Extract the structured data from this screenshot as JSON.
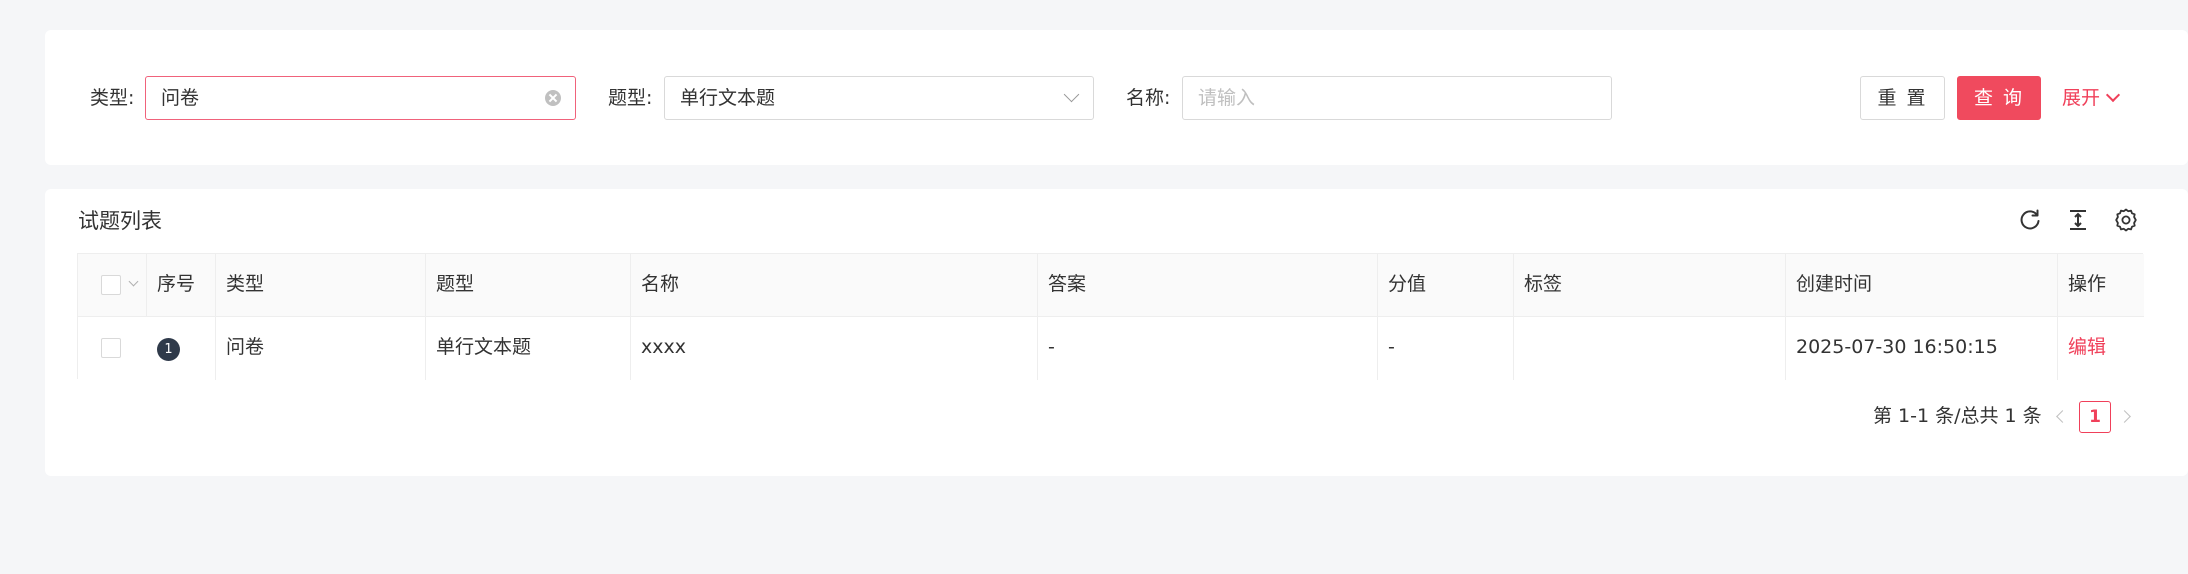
{
  "filters": {
    "type": {
      "label": "类型:",
      "value": "问卷"
    },
    "question_type": {
      "label": "题型:",
      "value": "单行文本题"
    },
    "name": {
      "label": "名称:",
      "placeholder": "请输入"
    }
  },
  "actions": {
    "reset_label": "重 置",
    "query_label": "查 询",
    "expand_label": "展开"
  },
  "list": {
    "title": "试题列表",
    "columns": [
      "序号",
      "类型",
      "题型",
      "名称",
      "答案",
      "分值",
      "标签",
      "创建时间",
      "操作"
    ],
    "rows": [
      {
        "index": "1",
        "type": "问卷",
        "question_type": "单行文本题",
        "name": "xxxx",
        "answer": "-",
        "score": "-",
        "tags": "",
        "created_at": "2025-07-30 16:50:15",
        "action": "编辑"
      }
    ]
  },
  "pagination": {
    "summary": "第 1-1 条/总共 1 条",
    "current_page": "1"
  },
  "colors": {
    "accent": "#f04a5e",
    "link": "#f0405a",
    "badge": "#2f3a4a"
  },
  "icons": [
    "clear-icon",
    "chevron-down-icon",
    "refresh-icon",
    "density-icon",
    "settings-icon",
    "chevron-left-icon",
    "chevron-right-icon"
  ]
}
